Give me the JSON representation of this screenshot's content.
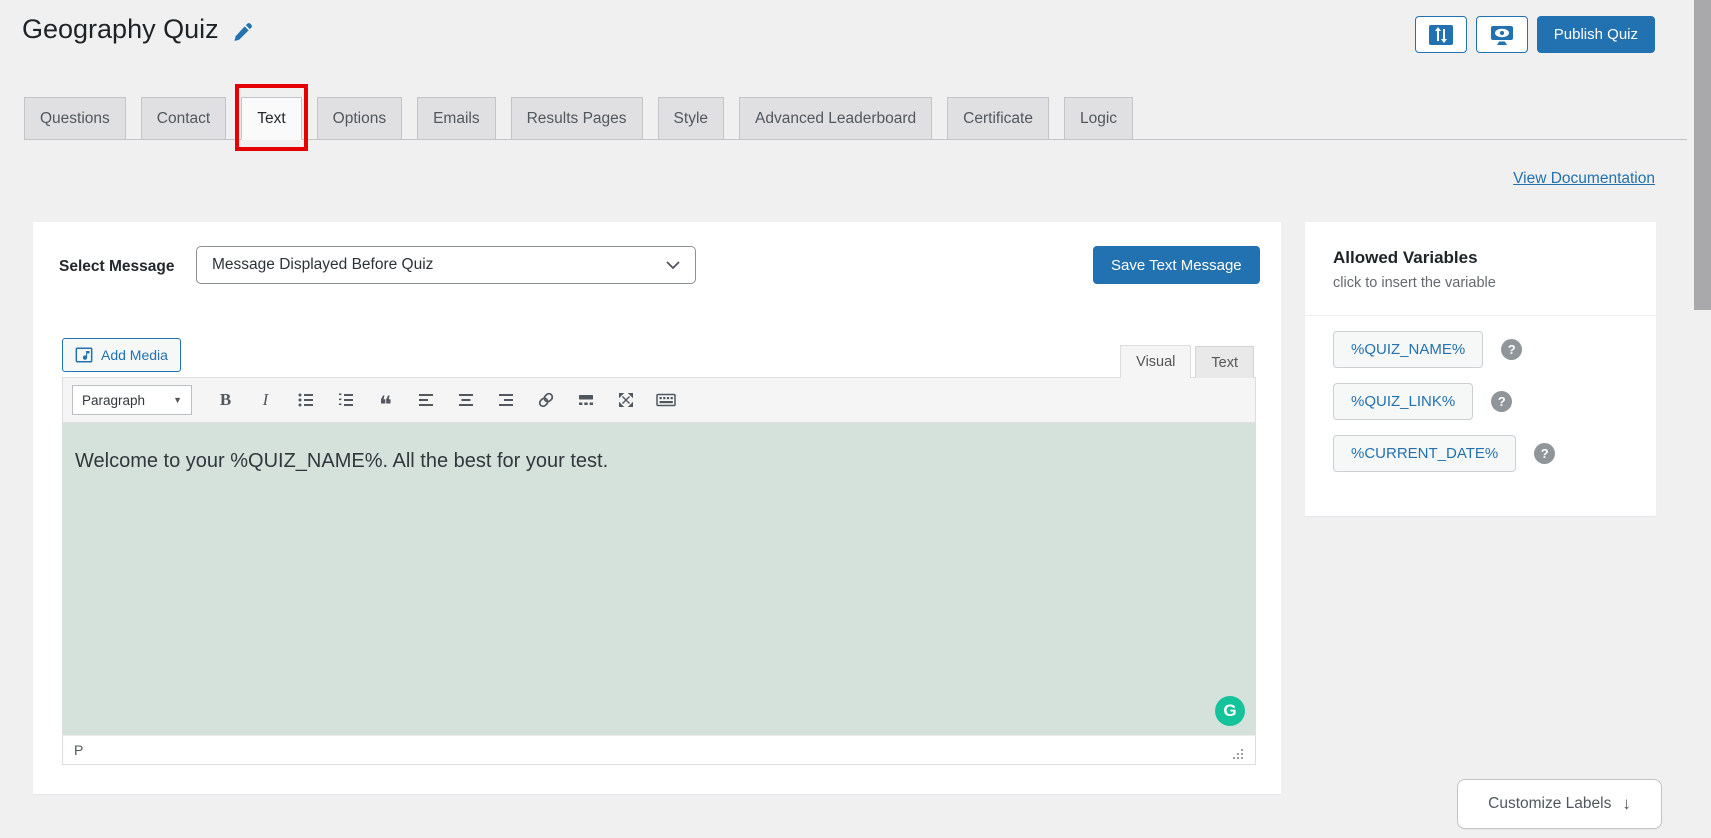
{
  "page": {
    "title": "Geography Quiz"
  },
  "header_actions": {
    "publish_label": "Publish Quiz"
  },
  "tabs": [
    {
      "label": "Questions",
      "active": false
    },
    {
      "label": "Contact",
      "active": false
    },
    {
      "label": "Text",
      "active": true
    },
    {
      "label": "Options",
      "active": false
    },
    {
      "label": "Emails",
      "active": false
    },
    {
      "label": "Results Pages",
      "active": false
    },
    {
      "label": "Style",
      "active": false
    },
    {
      "label": "Advanced Leaderboard",
      "active": false
    },
    {
      "label": "Certificate",
      "active": false
    },
    {
      "label": "Logic",
      "active": false
    }
  ],
  "doc_link_label": "View Documentation",
  "message_editor": {
    "select_label": "Select Message",
    "selected_option": "Message Displayed Before Quiz",
    "save_button_label": "Save Text Message",
    "add_media_label": "Add Media",
    "mode_tabs": {
      "visual": "Visual",
      "text": "Text"
    },
    "format_select_value": "Paragraph",
    "content_text": "Welcome to your %QUIZ_NAME%. All the best for your test.",
    "status_path": "P"
  },
  "allowed_variables": {
    "title": "Allowed Variables",
    "subtitle": "click to insert the variable",
    "items": [
      {
        "label": "%QUIZ_NAME%"
      },
      {
        "label": "%QUIZ_LINK%"
      },
      {
        "label": "%CURRENT_DATE%"
      }
    ]
  },
  "customize_labels_label": "Customize Labels",
  "icons": {
    "help": "?",
    "caret_down": "▼",
    "down_arrow": "↓",
    "blockquote": "❝",
    "bold": "B",
    "italic": "I",
    "grammarly": "G"
  },
  "colors": {
    "accent_blue": "#2271b1",
    "highlight_red": "#e60000",
    "editor_green": "#d5e2dc",
    "grammarly_green": "#15c39a",
    "page_background": "#f0f0f1"
  }
}
